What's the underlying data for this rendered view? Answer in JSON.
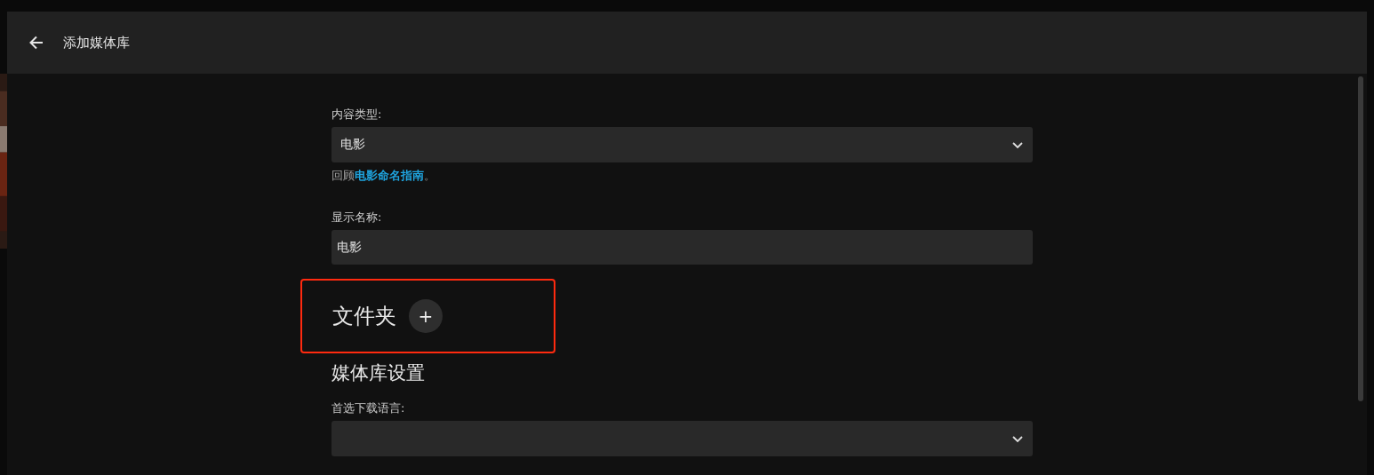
{
  "dialog": {
    "title": "添加媒体库"
  },
  "fields": [
    {
      "kind": "select",
      "label": "内容类型:",
      "value": "电影",
      "help": {
        "before": "回顾",
        "link": "电影命名指南",
        "after": "。"
      }
    },
    {
      "kind": "text",
      "label": "显示名称:",
      "value": "电影"
    }
  ],
  "folders": {
    "heading": "文件夹",
    "button": "+",
    "highlighted": true
  },
  "settings": {
    "heading": "媒体库设置",
    "fields": [
      {
        "kind": "select",
        "label": "首选下载语言:"
      }
    ]
  }
}
